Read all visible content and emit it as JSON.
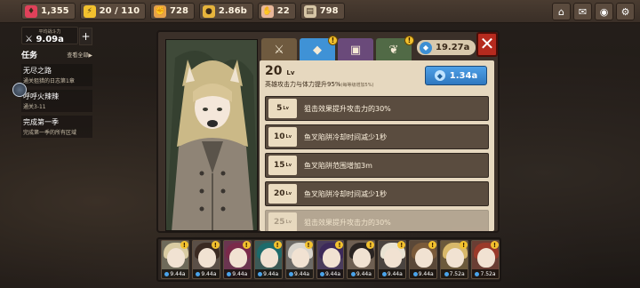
{
  "resources": [
    {
      "icon": "ruby-icon",
      "value": "1,355",
      "color": "#e0415a"
    },
    {
      "icon": "lightning-icon",
      "value": "20 / 110",
      "color": "#f2c12e"
    },
    {
      "icon": "fist-icon",
      "value": "728",
      "color": "#e8a24a"
    },
    {
      "icon": "coin-icon",
      "value": "2.86b",
      "color": "#e6b43c"
    },
    {
      "icon": "hand-icon",
      "value": "22",
      "color": "#e8b79a"
    },
    {
      "icon": "scroll-icon",
      "value": "798",
      "color": "#d6c6a6"
    }
  ],
  "top_buttons": [
    {
      "name": "castle-button",
      "icon": "castle-icon"
    },
    {
      "name": "mail-button",
      "icon": "mail-icon"
    },
    {
      "name": "camera-button",
      "icon": "camera-icon"
    },
    {
      "name": "settings-button",
      "icon": "gear-icon"
    }
  ],
  "power": {
    "title": "平均战斗力",
    "value": "9.09a"
  },
  "quests": {
    "title": "任务",
    "view_all": "查看全部▶",
    "items": [
      {
        "name": "无尽之路",
        "desc": "通关狙猎的日志第1章"
      },
      {
        "name": "呼呼火辣辣",
        "desc": "通关3-11"
      },
      {
        "name": "完成第一季",
        "desc": "完成第一季的所有区域"
      }
    ]
  },
  "tabs": [
    {
      "name": "weapons-tab",
      "icon": "crossed-swords-icon",
      "bg": "#6f5a3f",
      "alert": false
    },
    {
      "name": "skill-tab",
      "icon": "gem-icon",
      "bg": "#3f92d6",
      "alert": true
    },
    {
      "name": "book-tab",
      "icon": "book-icon",
      "bg": "#6a4a7a",
      "alert": false
    },
    {
      "name": "summon-tab",
      "icon": "leaf-icon",
      "bg": "#516a46",
      "alert": true
    }
  ],
  "currency": {
    "value": "19.27a"
  },
  "level": {
    "value": "20",
    "unit": "Lv",
    "desc": "英雄攻击力与体力提升95%",
    "sub": "(每等级增加5%)"
  },
  "upgrade": {
    "cost": "1.34a"
  },
  "perks": [
    {
      "lv": "5",
      "unit": "Lv",
      "text": "狙击效果提升攻击力的30%"
    },
    {
      "lv": "10",
      "unit": "Lv",
      "text": "鱼叉陷阱冷却时间减少1秒"
    },
    {
      "lv": "15",
      "unit": "Lv",
      "text": "鱼叉陷阱范围增加3m"
    },
    {
      "lv": "20",
      "unit": "Lv",
      "text": "鱼叉陷阱冷却时间减少1秒"
    },
    {
      "lv": "25",
      "unit": "Lv",
      "text": "狙击效果提升攻击力的30%"
    }
  ],
  "heroes": [
    {
      "cost": "9.44a",
      "hair": "#d9cba2",
      "bg": "#6e6a5a"
    },
    {
      "cost": "9.44a",
      "hair": "#3a2a22",
      "bg": "#5a4f47"
    },
    {
      "cost": "9.44a",
      "hair": "#7a2a4a",
      "bg": "#6b3550"
    },
    {
      "cost": "9.44a",
      "hair": "#1e6b6b",
      "bg": "#3c5a56"
    },
    {
      "cost": "9.44a",
      "hair": "#d8d4cc",
      "bg": "#6c6a66"
    },
    {
      "cost": "9.44a",
      "hair": "#3d2a5a",
      "bg": "#4a3c5c"
    },
    {
      "cost": "9.44a",
      "hair": "#2a2422",
      "bg": "#6e5f52"
    },
    {
      "cost": "9.44a",
      "hair": "#e8e2d2",
      "bg": "#4a4440"
    },
    {
      "cost": "9.44a",
      "hair": "#7a5a3a",
      "bg": "#5a4838"
    },
    {
      "cost": "7.52a",
      "hair": "#d8b86a",
      "bg": "#6c5a3c"
    },
    {
      "cost": "7.52a",
      "hair": "#9a3a2a",
      "bg": "#6a3e34"
    }
  ]
}
